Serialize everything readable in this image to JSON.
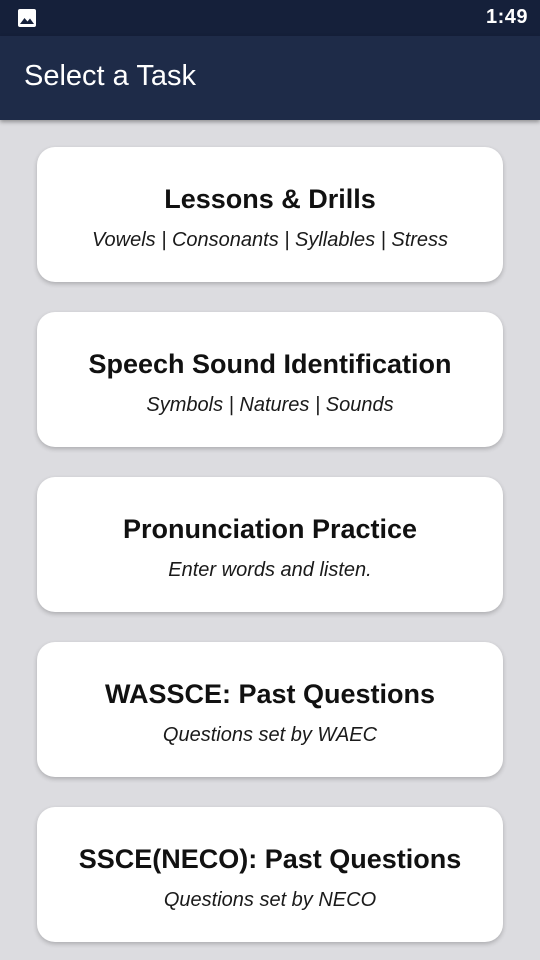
{
  "status_bar": {
    "time": "1:49",
    "left_icon": "gallery-icon"
  },
  "app_bar": {
    "title": "Select a Task"
  },
  "tasks": [
    {
      "title": "Lessons & Drills",
      "subtitle": "Vowels | Consonants | Syllables | Stress"
    },
    {
      "title": "Speech Sound Identification",
      "subtitle": "Symbols | Natures | Sounds"
    },
    {
      "title": "Pronunciation Practice",
      "subtitle": "Enter words and listen."
    },
    {
      "title": "WASSCE: Past Questions",
      "subtitle": "Questions set by WAEC"
    },
    {
      "title": "SSCE(NECO): Past Questions",
      "subtitle": "Questions set by NECO"
    }
  ],
  "colors": {
    "status_bar": "#15203a",
    "app_bar": "#1e2b48",
    "background": "#dcdce0",
    "card": "#ffffff"
  }
}
